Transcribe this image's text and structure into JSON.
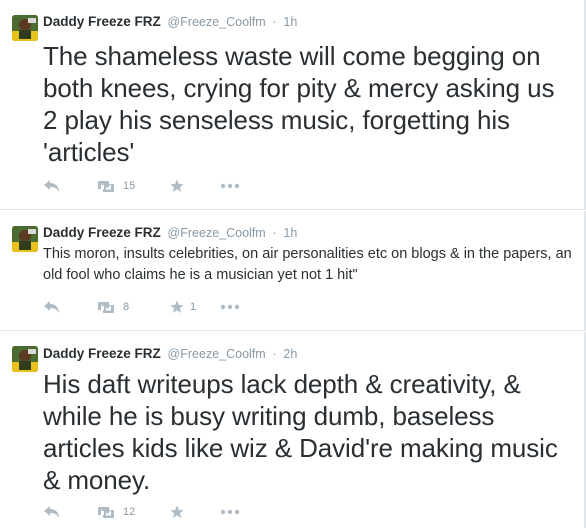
{
  "tweets": [
    {
      "fullname": "Daddy Freeze FRZ",
      "username": "@Freeze_Coolfm",
      "separator": "·",
      "time": "1h",
      "text": "The shameless waste will come begging on both knees, crying for pity & mercy asking us 2 play his senseless music, forgetting his 'articles'",
      "retweets": "15",
      "favorites": ""
    },
    {
      "fullname": "Daddy Freeze FRZ",
      "username": "@Freeze_Coolfm",
      "separator": "·",
      "time": "1h",
      "text": "This moron, insults celebrities, on air personalities etc on blogs & in the papers, an old fool who claims he is a musician yet not 1 hit\"",
      "retweets": "8",
      "favorites": "1"
    },
    {
      "fullname": "Daddy Freeze FRZ",
      "username": "@Freeze_Coolfm",
      "separator": "·",
      "time": "2h",
      "text": "His daft writeups lack depth & creativity, & while he is busy writing dumb, baseless articles kids like wiz & David're making music & money.",
      "retweets": "12",
      "favorites": ""
    }
  ],
  "icons": {
    "reply": "reply-icon",
    "retweet": "retweet-icon",
    "favorite": "star-icon",
    "more": "more-icon"
  },
  "colors": {
    "text": "#292f33",
    "muted": "#8899a6",
    "icon": "#b0bcc5",
    "border": "#e1e8ed"
  }
}
